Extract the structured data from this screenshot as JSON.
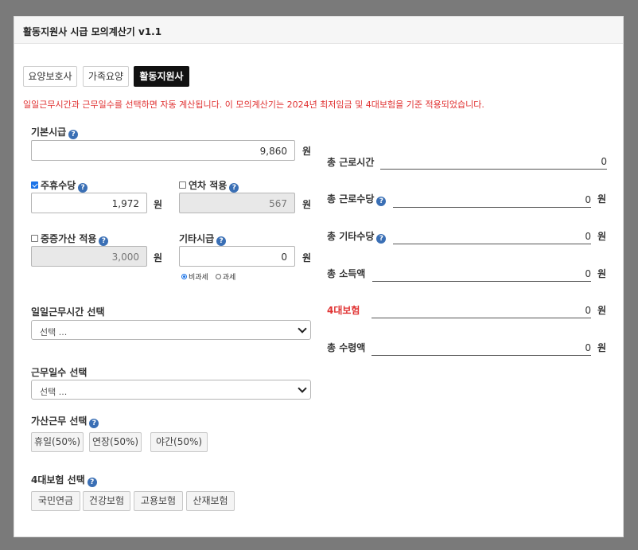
{
  "title": "활동지원사 시급 모의계산기 v1.1",
  "tabs": [
    {
      "label": "요양보호사"
    },
    {
      "label": "가족요양"
    },
    {
      "label": "활동지원사"
    }
  ],
  "notice": "일일근무시간과 근무일수를 선택하면 자동 계산됩니다. 이 모의계산기는 2024년 최저임금 및 4대보험을 기준 적용되었습니다.",
  "base_wage": {
    "label": "기본시급",
    "value": "9,860",
    "unit": "원"
  },
  "weekly_allowance": {
    "label": "주휴수당",
    "value": "1,972",
    "unit": "원",
    "checked": true
  },
  "annual_leave": {
    "label": "연차 적용",
    "value": "567",
    "unit": "원",
    "checked": false
  },
  "severe_bonus": {
    "label": "중증가산 적용",
    "value": "3,000",
    "unit": "원",
    "checked": false
  },
  "other_wage": {
    "label": "기타시급",
    "value": "0",
    "unit": "원",
    "tax_options": [
      "비과세",
      "과세"
    ],
    "selected": "비과세"
  },
  "daily_hours": {
    "label": "일일근무시간 선택",
    "placeholder": "선택 ..."
  },
  "work_days": {
    "label": "근무일수 선택",
    "placeholder": "선택 ..."
  },
  "extra_work": {
    "label": "가산근무 선택",
    "buttons": [
      "휴일(50%)",
      "연장(50%)",
      "야간(50%)"
    ]
  },
  "insurance": {
    "label": "4대보험 선택",
    "buttons": [
      "국민연금",
      "건강보험",
      "고용보험",
      "산재보험"
    ]
  },
  "summary": {
    "total_hours": {
      "label": "총 근로시간",
      "value": "0"
    },
    "total_work_pay": {
      "label": "총 근로수당",
      "value": "0",
      "unit": "원"
    },
    "total_other_pay": {
      "label": "총 기타수당",
      "value": "0",
      "unit": "원"
    },
    "total_income": {
      "label": "총 소득액",
      "value": "0",
      "unit": "원"
    },
    "insurance": {
      "label": "4대보험",
      "value": "0",
      "unit": "원"
    },
    "total_received": {
      "label": "총 수령액",
      "value": "0",
      "unit": "원"
    }
  },
  "colors": {
    "accent_red": "#e03131",
    "help_blue": "#3a6fb5",
    "active_tab": "#111111"
  }
}
